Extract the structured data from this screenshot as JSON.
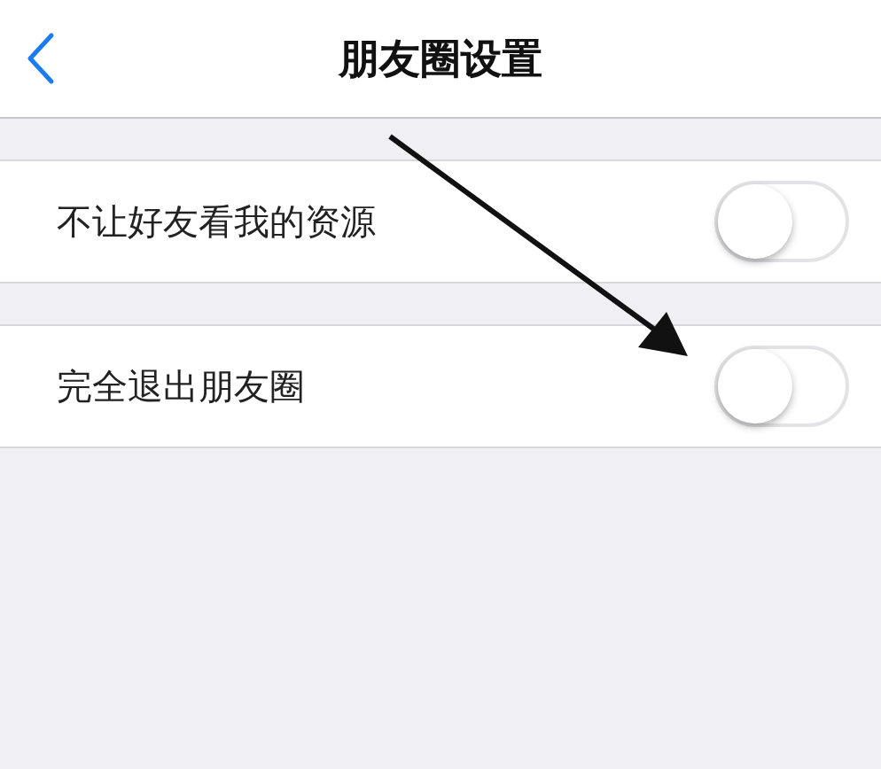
{
  "header": {
    "title": "朋友圈设置"
  },
  "settings": [
    {
      "label": "不让好友看我的资源",
      "on": false
    },
    {
      "label": "完全退出朋友圈",
      "on": false
    }
  ]
}
